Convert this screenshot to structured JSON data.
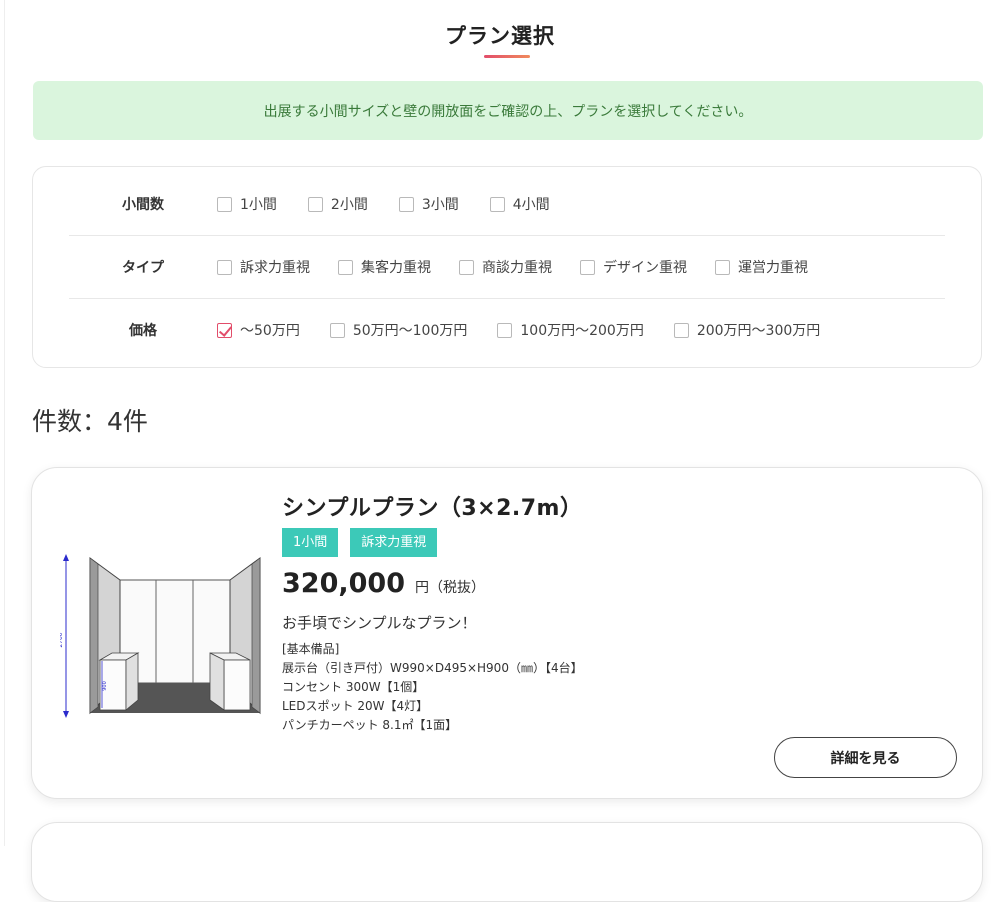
{
  "page": {
    "title": "プラン選択",
    "notice": "出展する小間サイズと壁の開放面をご確認の上、プランを選択してください。"
  },
  "filters": {
    "booths": {
      "label": "小間数",
      "options": [
        {
          "label": "1小間",
          "checked": false
        },
        {
          "label": "2小間",
          "checked": false
        },
        {
          "label": "3小間",
          "checked": false
        },
        {
          "label": "4小間",
          "checked": false
        }
      ]
    },
    "type": {
      "label": "タイプ",
      "options": [
        {
          "label": "訴求力重視",
          "checked": false
        },
        {
          "label": "集客力重視",
          "checked": false
        },
        {
          "label": "商談力重視",
          "checked": false
        },
        {
          "label": "デザイン重視",
          "checked": false
        },
        {
          "label": "運営力重視",
          "checked": false
        }
      ]
    },
    "price": {
      "label": "価格",
      "options": [
        {
          "label": "〜50万円",
          "checked": true
        },
        {
          "label": "50万円〜100万円",
          "checked": false
        },
        {
          "label": "100万円〜200万円",
          "checked": false
        },
        {
          "label": "200万円〜300万円",
          "checked": false
        }
      ]
    }
  },
  "results": {
    "count_label": "件数：4件"
  },
  "plans": [
    {
      "title": "シンプルプラン（3×2.7m）",
      "tags": [
        "1小間",
        "訴求力重視"
      ],
      "price": "320,000",
      "price_unit": "円（税抜）",
      "catchcopy": "お手頃でシンプルなプラン！",
      "specs_heading": "[基本備品]",
      "specs": [
        "展示台（引き戸付）W990×D495×H900（㎜）【4台】",
        "コンセント 300W【1個】",
        "LEDスポット 20W【4灯】",
        "パンチカーペット 8.1㎡【1面】"
      ],
      "detail_button": "詳細を見る",
      "image": {
        "dim_height": "2700",
        "dim_table": "900"
      }
    }
  ],
  "colors": {
    "accent": "#e24d6a",
    "tag": "#3cc9b8",
    "notice_bg": "#daf5dd",
    "notice_text": "#3a7a3a"
  }
}
